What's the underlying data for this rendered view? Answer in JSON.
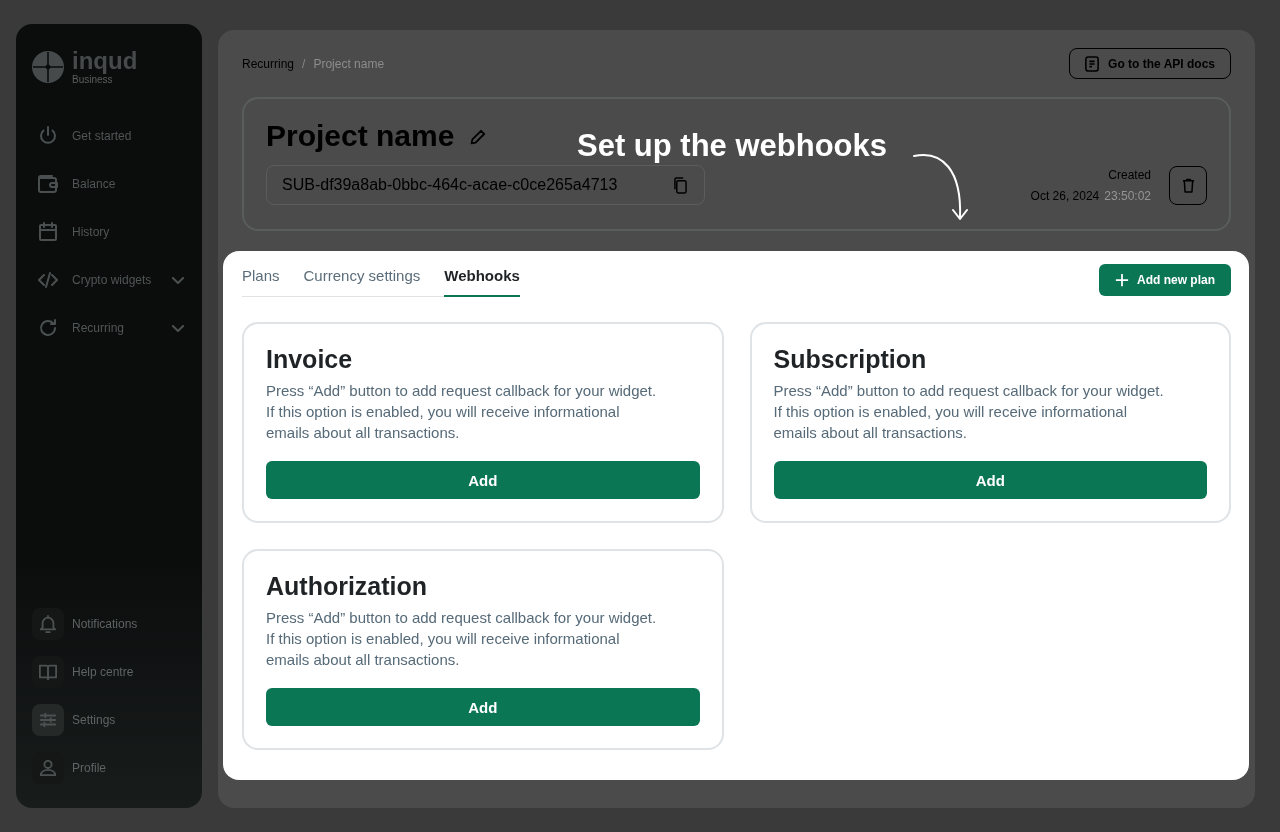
{
  "sidebar": {
    "brand": "inqud",
    "brand_subtitle": "Business",
    "items": [
      {
        "label": "Get started",
        "expandable": false,
        "selected": false
      },
      {
        "label": "Balance",
        "expandable": false,
        "selected": false
      },
      {
        "label": "History",
        "expandable": false,
        "selected": false
      },
      {
        "label": "Crypto widgets",
        "expandable": true,
        "selected": false
      },
      {
        "label": "Recurring",
        "expandable": true,
        "selected": false
      }
    ],
    "bottom_items": [
      {
        "label": "Notifications",
        "selected": false
      },
      {
        "label": "Help centre",
        "selected": false
      },
      {
        "label": "Settings",
        "selected": true
      },
      {
        "label": "Profile",
        "selected": false
      }
    ]
  },
  "breadcrumb": {
    "items": [
      "Recurring",
      "Project name"
    ],
    "separator": "/"
  },
  "api_docs_button": {
    "label": "Go to the API docs"
  },
  "project": {
    "title": "Project name",
    "id_value": "SUB-df39a8ab-0bbc-464c-acae-c0ce265a4713",
    "created_label": "Created",
    "created_date": "Oct 26, 2024",
    "created_time": "23:50:02"
  },
  "callout": {
    "text": "Set up the webhooks"
  },
  "tabs": [
    {
      "label": "Plans",
      "selected": false
    },
    {
      "label": "Currency settings",
      "selected": false
    },
    {
      "label": "Webhooks",
      "selected": true
    }
  ],
  "add_plan_button": {
    "label": "Add new plan"
  },
  "webhooks": [
    {
      "title": "Invoice",
      "description": "Press “Add” button to add request callback for your widget.",
      "note": "If this option is enabled, you will receive informational emails about all transactions.",
      "button": "Add"
    },
    {
      "title": "Subscription",
      "description": "Press “Add” button to add request callback for your widget.",
      "note": "If this option is enabled, you will receive informational emails about all transactions.",
      "button": "Add"
    },
    {
      "title": "Authorization",
      "description": "Press “Add” button to add request callback for your widget.",
      "note": "If this option is enabled, you will receive informational emails about all transactions.",
      "button": "Add"
    }
  ]
}
